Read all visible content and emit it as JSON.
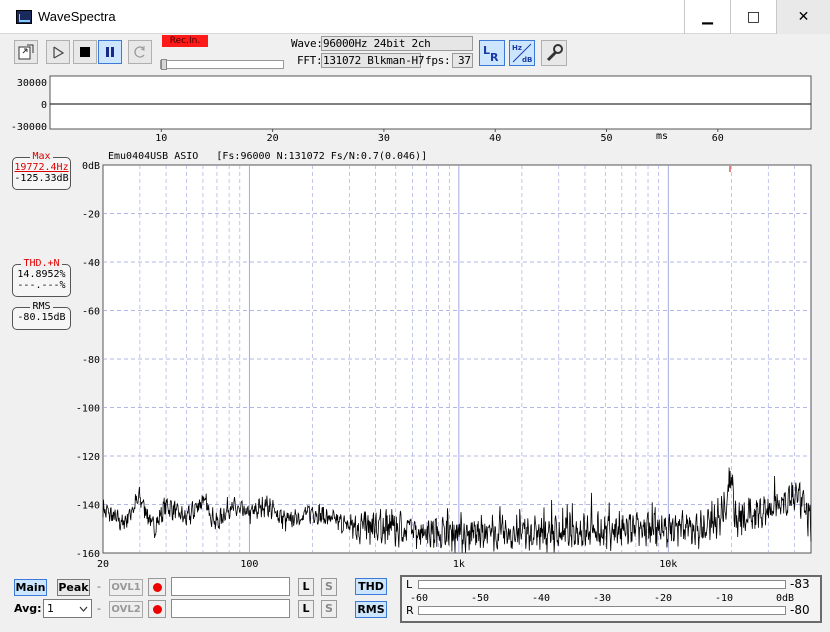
{
  "window": {
    "title": "WaveSpectra",
    "minimize_glyph": "▁",
    "maximize_glyph": "□",
    "close_glyph": "✕"
  },
  "toolbar": {
    "rec_label": "Rec.In.",
    "wave_label": "Wave:",
    "wave_value": "96000Hz 24bit 2ch",
    "fft_label": "FFT:",
    "fft_value": "131072 Blkman-H7",
    "fps_label": "fps:",
    "fps_value": "37",
    "icons": [
      "open-file-icon",
      "play-icon",
      "stop-icon",
      "pause-icon",
      "loop-icon",
      "lr-channel-icon",
      "hz-db-scale-icon",
      "settings-wrench-icon"
    ]
  },
  "waveform": {
    "y_ticks": [
      "30000",
      "0",
      "-30000"
    ],
    "x_ticks": [
      "10",
      "20",
      "30",
      "40",
      "50",
      "60"
    ],
    "x_unit": "ms"
  },
  "spectrum": {
    "header": "Emu0404USB ASIO   [Fs:96000 N:131072 Fs/N:0.7(0.046)]",
    "y_ticks": [
      "0dB",
      "-20",
      "-40",
      "-60",
      "-80",
      "-100",
      "-120",
      "-140",
      "-160"
    ],
    "x_ticks": [
      "20",
      "100",
      "1k",
      "10k"
    ],
    "max_box": {
      "caption": "Max",
      "freq": "19772.4Hz",
      "level": "-125.33dB"
    },
    "thd_box": {
      "caption": "THD.+N",
      "value1": "14.8952%",
      "value2": "---.---%"
    },
    "rms_box": {
      "caption": "RMS",
      "value": "-80.15dB"
    }
  },
  "chart_data": {
    "type": "line",
    "title": "",
    "xlabel": "",
    "ylabel": "",
    "x_scale": "log",
    "xlim": [
      20,
      48000
    ],
    "ylim": [
      -160,
      0
    ],
    "grid": true,
    "series": [
      {
        "x": [
          20,
          25,
          30,
          35,
          40,
          50,
          60,
          70,
          80,
          100,
          120,
          150,
          200,
          300,
          500,
          700,
          1000,
          2000,
          5000,
          10000,
          15000,
          19000,
          19772,
          21000,
          30000,
          40000,
          45000,
          48000
        ],
        "y": [
          -142,
          -148,
          -137,
          -150,
          -140,
          -146,
          -138,
          -148,
          -141,
          -144,
          -140,
          -147,
          -143,
          -149,
          -150,
          -151,
          -152,
          -152,
          -151,
          -150,
          -150,
          -142,
          -125,
          -147,
          -142,
          -136,
          -141,
          -150
        ]
      }
    ]
  },
  "bottom": {
    "main_label": "Main",
    "peak_label": "Peak",
    "dash": "-",
    "ovl1_label": "OVL1",
    "ovl2_label": "OVL2",
    "l_label": "L",
    "s_label": "S",
    "avg_label": "Avg:",
    "avg_value": "1",
    "thd_label": "THD",
    "rms_label": "RMS"
  },
  "meter": {
    "scale": [
      "-60",
      "-50",
      "-40",
      "-30",
      "-20",
      "-10",
      "0dB"
    ],
    "left_label": "L",
    "right_label": "R",
    "left_value": "-83",
    "right_value": "-80"
  }
}
